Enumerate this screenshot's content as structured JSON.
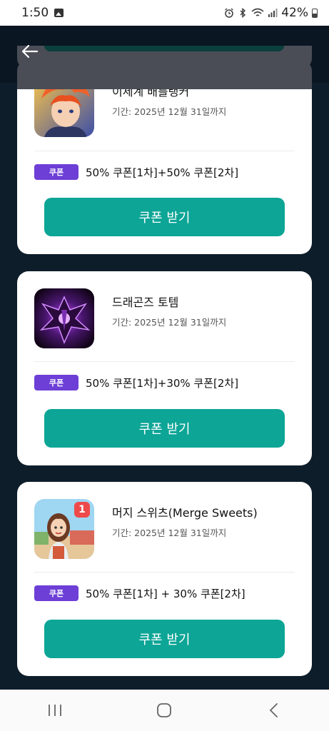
{
  "status_bar": {
    "time": "1:50",
    "battery": "42%"
  },
  "header": {
    "back_icon": "arrow-left-icon"
  },
  "coupons": [
    {
      "title": "이세계 배틀랭커",
      "period": "기간: 2025년 12월 31일까지",
      "badge": "쿠폰",
      "description": "50% 쿠폰[1차]+50% 쿠폰[2차]",
      "button": "쿠폰 받기",
      "icon": "anime-hero-game-icon"
    },
    {
      "title": "드래곤즈 토템",
      "period": "기간: 2025년 12월 31일까지",
      "badge": "쿠폰",
      "description": "50% 쿠폰[1차]+30% 쿠폰[2차]",
      "button": "쿠폰 받기",
      "icon": "dark-dragon-game-icon"
    },
    {
      "title": "머지 스위츠(Merge Sweets)",
      "period": "기간: 2025년 12월 31일까지",
      "badge": "쿠폰",
      "description": "50% 쿠폰[1차] + 30% 쿠폰[2차]",
      "button": "쿠폰 받기",
      "icon": "merge-sweets-game-icon",
      "icon_badge": "1"
    }
  ],
  "colors": {
    "background": "#0e1d2a",
    "badge": "#6d3fd6",
    "button": "#0ca596"
  }
}
